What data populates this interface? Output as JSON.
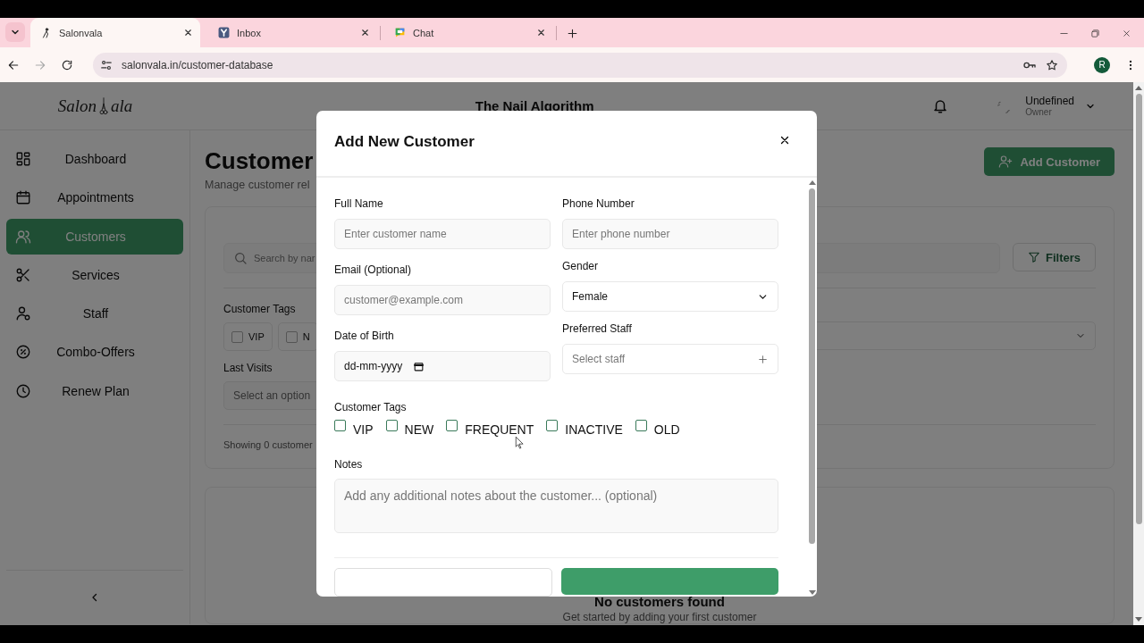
{
  "browser": {
    "tabs": [
      {
        "title": "Salonvala",
        "selected": true
      },
      {
        "title": "Inbox",
        "selected": false
      },
      {
        "title": "Chat",
        "selected": false
      }
    ],
    "url": "salonvala.in/customer-database",
    "profile_initial": "R"
  },
  "header": {
    "logo_left": "Salon",
    "logo_right": "ala",
    "business_name": "The Nail Algorithm",
    "user_name": "Undefined",
    "user_role": "Owner"
  },
  "sidebar": {
    "items": [
      {
        "label": "Dashboard",
        "selected": false
      },
      {
        "label": "Appointments",
        "selected": false
      },
      {
        "label": "Customers",
        "selected": true
      },
      {
        "label": "Services",
        "selected": false
      },
      {
        "label": "Staff",
        "selected": false
      },
      {
        "label": "Combo-Offers",
        "selected": false
      },
      {
        "label": "Renew Plan",
        "selected": false
      }
    ]
  },
  "page": {
    "title": "Customer",
    "subtitle": "Manage customer rel",
    "add_button": "Add Customer",
    "search_placeholder": "Search by nar",
    "filters_button": "Filters",
    "tags_label": "Customer Tags",
    "tags": [
      {
        "label": "VIP",
        "checked": false
      },
      {
        "label": "N",
        "checked": false
      }
    ],
    "last_visits_label": "Last Visits",
    "last_visits_placeholder": "Select an option",
    "showing": "Showing 0 customer",
    "empty_title": "No customers found",
    "empty_text": "Get started by adding your first customer"
  },
  "modal": {
    "title": "Add New Customer",
    "left_fields": [
      {
        "kind": "text",
        "label": "Full Name",
        "placeholder": "Enter customer name"
      },
      {
        "kind": "text",
        "label": "Email (Optional)",
        "placeholder": "customer@example.com"
      },
      {
        "kind": "date",
        "label": "Date of Birth",
        "value": "dd-mm-yyyy"
      }
    ],
    "right_fields": [
      {
        "kind": "text",
        "label": "Phone Number",
        "placeholder": "Enter phone number"
      },
      {
        "kind": "select",
        "label": "Gender",
        "value": "Female"
      },
      {
        "kind": "picker",
        "label": "Preferred Staff",
        "placeholder": "Select staff"
      }
    ],
    "tags_label": "Customer Tags",
    "tags": [
      {
        "label": "VIP",
        "checked": false
      },
      {
        "label": "NEW",
        "checked": false
      },
      {
        "label": "FREQUENT",
        "checked": false
      },
      {
        "label": "INACTIVE",
        "checked": false
      },
      {
        "label": "OLD",
        "checked": false
      }
    ],
    "notes_label": "Notes",
    "notes_placeholder": "Add any additional notes about the customer... (optional)"
  }
}
